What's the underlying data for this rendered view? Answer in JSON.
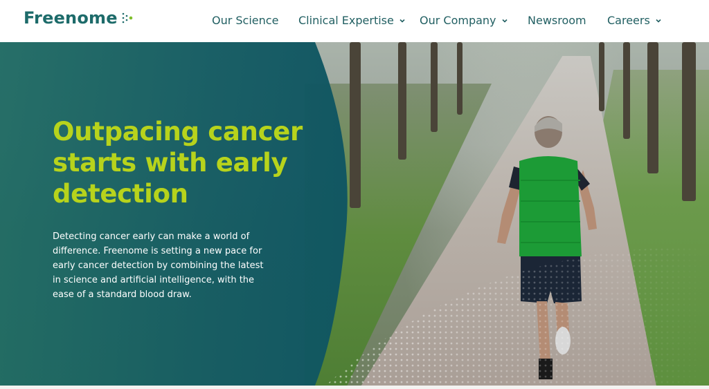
{
  "brand": {
    "name": "Freenome",
    "logo_icon": "dots-icon",
    "color": "#1d6b6a"
  },
  "nav": {
    "items": [
      {
        "label": "Our Science",
        "has_dropdown": false
      },
      {
        "label": "Clinical Expertise",
        "has_dropdown": true
      },
      {
        "label": "Our Company",
        "has_dropdown": true
      },
      {
        "label": "Newsroom",
        "has_dropdown": false
      },
      {
        "label": "Careers",
        "has_dropdown": true
      }
    ],
    "dropdown_icon": "chevron-down-icon"
  },
  "hero": {
    "headline": "Outpacing cancer starts with early detection",
    "body": "Detecting cancer early can make a world of difference. Freenome is setting a new pace for early cancer detection by combining the latest in science and artificial intelligence, with the ease of a standard blood draw.",
    "image": "runner-on-tree-lined-path",
    "headline_color": "#b7d31c",
    "panel_color": "#155d63"
  }
}
